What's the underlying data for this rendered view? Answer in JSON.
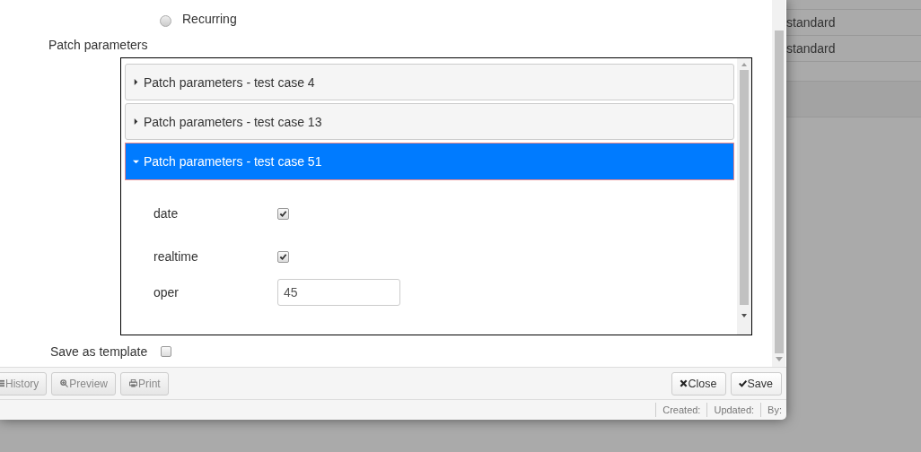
{
  "background_table": {
    "rows": [
      {
        "cell": "standard"
      },
      {
        "cell": "standard"
      }
    ]
  },
  "dialog": {
    "schedule_option": {
      "label": "Recurring",
      "selected": false
    },
    "section_label": "Patch parameters",
    "panels": [
      {
        "title": "Patch parameters - test case 4",
        "expanded": false
      },
      {
        "title": "Patch parameters - test case 13",
        "expanded": false
      },
      {
        "title": "Patch parameters - test case 51",
        "expanded": true,
        "fields": [
          {
            "kind": "checkbox",
            "label": "date",
            "checked": true
          },
          {
            "kind": "checkbox",
            "label": "realtime",
            "checked": true
          },
          {
            "kind": "text",
            "label": "oper",
            "value": "45"
          }
        ]
      }
    ],
    "save_as_template": {
      "label": "Save as template",
      "checked": false
    },
    "footer_left": [
      {
        "kind": "list",
        "label": "History"
      },
      {
        "kind": "zoom",
        "label": "Preview"
      },
      {
        "kind": "print",
        "label": "Print"
      }
    ],
    "footer_right": [
      {
        "kind": "close",
        "label": "Close"
      },
      {
        "kind": "check",
        "label": "Save"
      }
    ],
    "status_bar": [
      "Created:",
      "Updated:",
      "By:"
    ]
  }
}
